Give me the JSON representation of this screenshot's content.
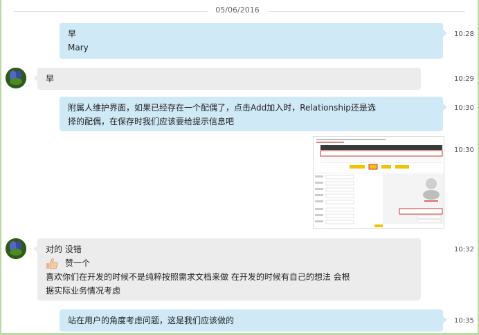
{
  "date_separator": "05/06/2016",
  "messages": [
    {
      "lines": [
        "早",
        "Mary"
      ],
      "time": "10:28"
    },
    {
      "lines": [
        "早"
      ],
      "time": "10:29"
    },
    {
      "lines": [
        "附属人维护界面，如果已经存在一个配偶了，点击Add加入时，Relationship还是选",
        "择的配偶，在保存时我们应该要给提示信息吧"
      ],
      "time": "10:30"
    },
    {
      "image_alt": "screenshot",
      "time": "10:30"
    },
    {
      "lines": [
        "对的 没错",
        "赞一个",
        "喜欢你们在开发的时候不是纯粹按照需求文档来做 在开发的时候有自己的想法  会根",
        "据实际业务情况考虑"
      ],
      "time": "10:32"
    },
    {
      "lines": [
        "站在用户的角度考虑问题，这是我们应该做的"
      ],
      "time": "10:35"
    }
  ],
  "colors": {
    "self_bubble": "#cfe9f7",
    "other_bubble": "#ececec",
    "frame": "#bcd9a4"
  }
}
